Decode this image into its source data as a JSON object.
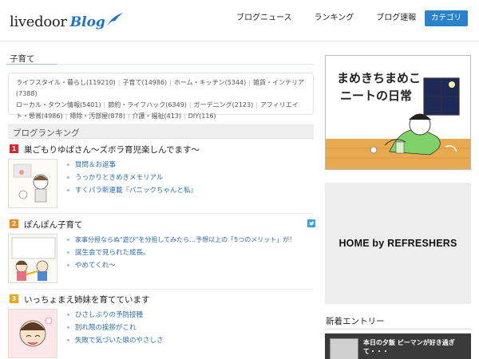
{
  "header": {
    "logo_text": "livedoor",
    "logo_blog": "Blog",
    "nav": [
      "ブログニュース",
      "ランキング",
      "ブログ速報"
    ],
    "category_button": "カテゴリ"
  },
  "category_section": {
    "title": "子育て",
    "links": [
      "ライフスタイル・暮らし(119210)",
      "子育て(14986)",
      "ホーム・キッチン(5344)",
      "雑貨・インテリア(7388)",
      "ローカル・タウン情報(5401)",
      "節約・ライフハック(6349)",
      "ガーデニング(2123)",
      "アフィリエイト・懸賞(4986)",
      "掃除・汚部屋(878)",
      "介護・福祉(413)",
      "DIY(116)"
    ]
  },
  "ranking": {
    "title": "ブログランキング",
    "entries": [
      {
        "rank": "1",
        "rank_color": "#d9262b",
        "title": "巣ごもりゆばさん〜ズボラ育児楽しんでます〜",
        "items": [
          "質問＆お返事",
          "うっかりときめきメモリアル",
          "すくパラ新連載『パニックちゃんと私』"
        ]
      },
      {
        "rank": "2",
        "rank_color": "#f08a1c",
        "title": "ぽんぽん子育て",
        "items": [
          "家事分担ならぬ\"遊び\"を分担してみたら…予想以上の「5つのメリット」が！",
          "誕生会で見られた成長。",
          "やめてくれ〜"
        ]
      },
      {
        "rank": "3",
        "rank_color": "#f2a516",
        "title": "いっちょまえ姉妹を育てています",
        "items": [
          "ひさしぶりの予防接種",
          "別れ際の挨拶がこれ",
          "失敗で気づいた娘のやさしさ"
        ]
      }
    ]
  },
  "sidebar": {
    "banner_text": "まめきちまめこ ニートの日常",
    "ad_text": "HOME by REFRESHERS",
    "new_entries_title": "新着エントリー",
    "new_entry_text": "本日の夕飯 ピーマンが好き過ぎて・・・"
  },
  "colors": {
    "accent": "#2a82c9",
    "link": "#2a6db5",
    "rank1": "#d9262b",
    "rank2": "#f08a1c",
    "rank3": "#f2a516"
  }
}
